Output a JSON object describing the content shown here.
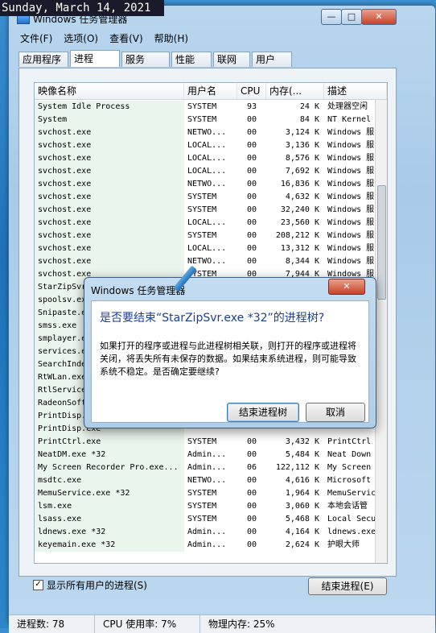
{
  "overlay_date": "Sunday, March 14, 2021",
  "window": {
    "title": "Windows 任务管理器",
    "min": "—",
    "max": "□",
    "close": "✕"
  },
  "menu": [
    "文件(F)",
    "选项(O)",
    "查看(V)",
    "帮助(H)"
  ],
  "tabs": [
    "应用程序",
    "进程",
    "服务",
    "性能",
    "联网",
    "用户"
  ],
  "active_tab": "进程",
  "columns": [
    "映像名称",
    "用户名",
    "CPU",
    "内存(...",
    "描述"
  ],
  "rows": [
    [
      "System Idle Process",
      "SYSTEM",
      "93",
      "24 K",
      "处理器空闲"
    ],
    [
      "System",
      "SYSTEM",
      "00",
      "84 K",
      "NT Kernel"
    ],
    [
      "svchost.exe",
      "NETWO...",
      "00",
      "3,124 K",
      "Windows 服"
    ],
    [
      "svchost.exe",
      "LOCAL...",
      "00",
      "3,136 K",
      "Windows 服"
    ],
    [
      "svchost.exe",
      "LOCAL...",
      "00",
      "8,576 K",
      "Windows 服"
    ],
    [
      "svchost.exe",
      "LOCAL...",
      "00",
      "7,692 K",
      "Windows 服"
    ],
    [
      "svchost.exe",
      "NETWO...",
      "00",
      "16,836 K",
      "Windows 服"
    ],
    [
      "svchost.exe",
      "SYSTEM",
      "00",
      "4,632 K",
      "Windows 服"
    ],
    [
      "svchost.exe",
      "SYSTEM",
      "00",
      "32,240 K",
      "Windows 服"
    ],
    [
      "svchost.exe",
      "LOCAL...",
      "00",
      "23,560 K",
      "Windows 服"
    ],
    [
      "svchost.exe",
      "SYSTEM",
      "00",
      "208,212 K",
      "Windows 服"
    ],
    [
      "svchost.exe",
      "LOCAL...",
      "00",
      "13,312 K",
      "Windows 服"
    ],
    [
      "svchost.exe",
      "NETWO...",
      "00",
      "8,344 K",
      "Windows 服"
    ],
    [
      "svchost.exe",
      "SYSTEM",
      "00",
      "7,944 K",
      "Windows 服"
    ],
    [
      "StarZipSvr.exe *32",
      "",
      "",
      "",
      ""
    ],
    [
      "spoolsv.exe",
      "",
      "",
      "",
      ""
    ],
    [
      "Snipaste.exe",
      "",
      "",
      "",
      ""
    ],
    [
      "smss.exe",
      "",
      "",
      "",
      ""
    ],
    [
      "smplayer.exe",
      "",
      "",
      "",
      ""
    ],
    [
      "services.exe",
      "",
      "",
      "",
      ""
    ],
    [
      "SearchIndexer.exe",
      "",
      "",
      "",
      ""
    ],
    [
      "RtWLan.exe",
      "",
      "",
      "",
      ""
    ],
    [
      "RtlService.exe",
      "",
      "",
      "",
      ""
    ],
    [
      "RadeonSoftware.exe",
      "",
      "",
      "",
      ""
    ],
    [
      "PrintDisp.exe",
      "",
      "",
      "",
      ""
    ],
    [
      "PrintDisp.exe",
      "",
      "",
      "",
      ""
    ],
    [
      "PrintCtrl.exe",
      "SYSTEM",
      "00",
      "3,432 K",
      "PrintCtrl"
    ],
    [
      "NeatDM.exe *32",
      "Admin...",
      "00",
      "5,484 K",
      "Neat Down"
    ],
    [
      "My Screen Recorder Pro.exe...",
      "Admin...",
      "06",
      "122,112 K",
      "My Screen"
    ],
    [
      "msdtc.exe",
      "NETWO...",
      "00",
      "4,616 K",
      "Microsoft"
    ],
    [
      "MemuService.exe *32",
      "SYSTEM",
      "00",
      "1,964 K",
      "MemuServic"
    ],
    [
      "lsm.exe",
      "SYSTEM",
      "00",
      "3,060 K",
      "本地会话管"
    ],
    [
      "lsass.exe",
      "SYSTEM",
      "00",
      "5,468 K",
      "Local Secu"
    ],
    [
      "ldnews.exe *32",
      "Admin...",
      "00",
      "4,164 K",
      "ldnews.exe"
    ],
    [
      "keyemain.exe *32",
      "Admin...",
      "00",
      "2,624 K",
      "护眼大师"
    ]
  ],
  "show_all_label": "显示所有用户的进程(S)",
  "show_all_checked": "✓",
  "end_process_btn": "结束进程(E)",
  "status": {
    "processes": "进程数: 78",
    "cpu": "CPU 使用率: 7%",
    "memory": "物理内存: 25%"
  },
  "dialog": {
    "title": "Windows 任务管理器",
    "close": "✕",
    "question": "是否要结束“StarZipSvr.exe *32”的进程树?",
    "message": "如果打开的程序或进程与此进程树相关联，则打开的程序或进程将关闭，将丢失所有未保存的数据。如果结束系统进程，则可能导致系统不稳定。是否确定要继续?",
    "confirm": "结束进程树",
    "cancel": "取消"
  }
}
